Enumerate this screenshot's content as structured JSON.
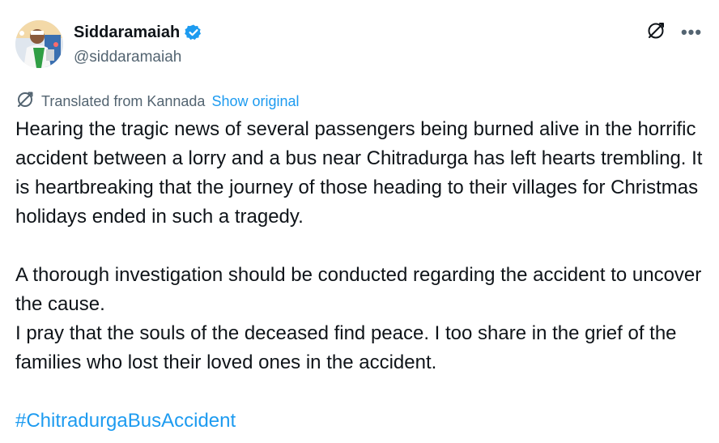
{
  "author": {
    "display_name": "Siddaramaiah",
    "handle": "@siddaramaiah",
    "verified": true,
    "verified_color": "#1d9bf0"
  },
  "actions": {
    "translate_icon": "translate-icon",
    "more_icon": "more-icon",
    "more_label": "•••"
  },
  "translation": {
    "label": "Translated from Kannada",
    "show_original": "Show original"
  },
  "tweet": {
    "paragraph_1": "Hearing the tragic news of several passengers being burned alive in the horrific accident between a lorry and a bus near Chitradurga has left hearts trembling. It is heartbreaking that the journey of those heading to their villages for Christmas holidays ended in such a tragedy.",
    "paragraph_2": "A thorough investigation should be conducted regarding the accident to uncover the cause.",
    "paragraph_3": "I pray that the souls of the deceased find peace. I too share in the grief of the families who lost their loved ones in the accident.",
    "hashtag": "#ChitradurgaBusAccident"
  },
  "colors": {
    "text": "#0f1419",
    "secondary": "#536471",
    "link": "#1d9bf0"
  }
}
